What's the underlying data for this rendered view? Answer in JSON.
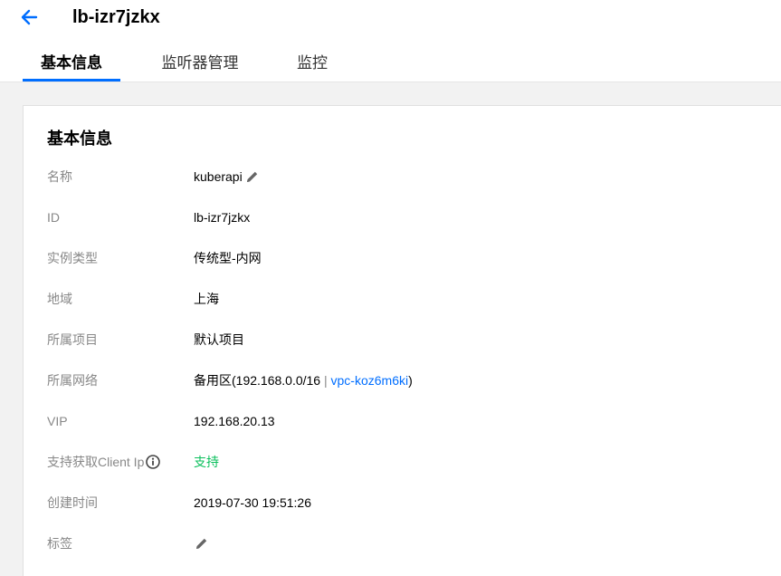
{
  "header": {
    "title": "lb-izr7jzkx",
    "tabs": [
      {
        "label": "基本信息"
      },
      {
        "label": "监听器管理"
      },
      {
        "label": "监控"
      }
    ]
  },
  "card": {
    "title": "基本信息",
    "rows": {
      "name": {
        "label": "名称",
        "value": "kuberapi"
      },
      "id": {
        "label": "ID",
        "value": "lb-izr7jzkx"
      },
      "instance_type": {
        "label": "实例类型",
        "value": "传统型-内网"
      },
      "region": {
        "label": "地域",
        "value": "上海"
      },
      "project": {
        "label": "所属项目",
        "value": "默认项目"
      },
      "network": {
        "label": "所属网络",
        "prefix": "备用区(192.168.0.0/16 ",
        "separator": "|",
        "vpc_link": "vpc-koz6m6ki",
        "suffix": ")"
      },
      "vip": {
        "label": "VIP",
        "value": "192.168.20.13"
      },
      "client_ip": {
        "label": "支持获取Client Ip",
        "value": "支持"
      },
      "created": {
        "label": "创建时间",
        "value": "2019-07-30 19:51:26"
      },
      "tags": {
        "label": "标签"
      }
    }
  },
  "colors": {
    "accent": "#006eff",
    "success": "#0abf5b",
    "label": "#888888"
  },
  "icons": {
    "back": "arrow-left-icon",
    "edit": "pencil-icon",
    "info": "info-circle-icon"
  }
}
